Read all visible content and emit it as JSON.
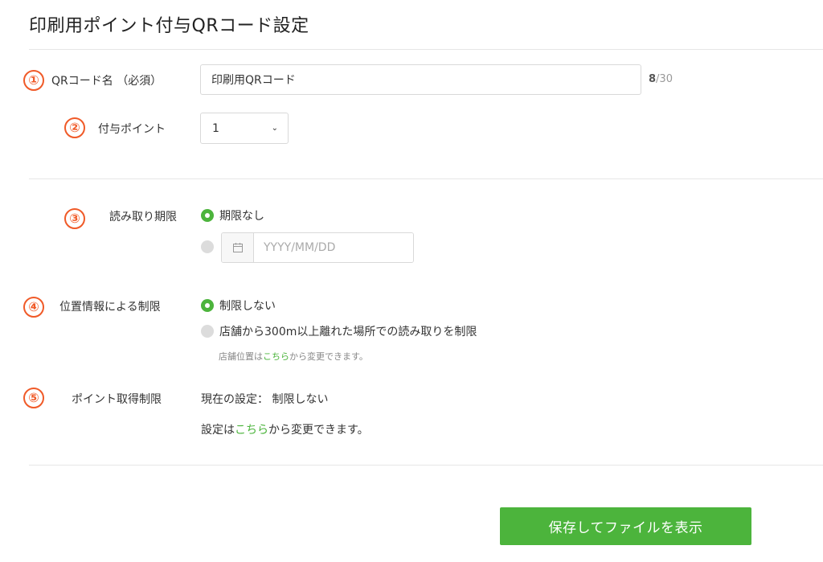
{
  "page_title": "印刷用ポイント付与QRコード設定",
  "qr_name": {
    "marker": "①",
    "label": "QRコード名 （必須）",
    "value": "印刷用QRコード",
    "count_current": "8",
    "count_max": "/30"
  },
  "points": {
    "marker": "②",
    "label": "付与ポイント",
    "selected": "1"
  },
  "expiry": {
    "marker": "③",
    "label": "読み取り期限",
    "option_none": "期限なし",
    "date_placeholder": "YYYY/MM/DD"
  },
  "location": {
    "marker": "④",
    "label": "位置情報による制限",
    "option_none": "制限しない",
    "option_limit": "店舗から300m以上離れた場所での読み取りを制限",
    "note_prefix": "店舗位置は",
    "note_link": "こちら",
    "note_suffix": "から変更できます。"
  },
  "point_limit": {
    "marker": "⑤",
    "label": "ポイント取得制限",
    "current_prefix": "現在の設定：",
    "current_value": "制限しない",
    "change_prefix": "設定は",
    "change_link": "こちら",
    "change_suffix": "から変更できます。"
  },
  "save_button": "保存してファイルを表示",
  "colors": {
    "accent": "#4cb43c",
    "marker": "#f05a28"
  }
}
